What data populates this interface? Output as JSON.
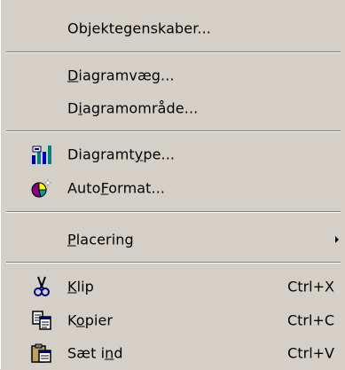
{
  "menu": {
    "items": [
      {
        "label_pre": "Ob",
        "label_acc": "j",
        "label_post": "ektegenskaber...",
        "shortcut": "",
        "icon": "",
        "submenu": false
      },
      {
        "label_pre": "",
        "label_acc": "D",
        "label_post": "iagramvæg...",
        "shortcut": "",
        "icon": "",
        "submenu": false
      },
      {
        "label_pre": "D",
        "label_acc": "i",
        "label_post": "agramområde...",
        "shortcut": "",
        "icon": "",
        "submenu": false
      },
      {
        "label_pre": "Diagramt",
        "label_acc": "y",
        "label_post": "pe...",
        "shortcut": "",
        "icon": "chart-type-icon",
        "submenu": false
      },
      {
        "label_pre": "Auto",
        "label_acc": "F",
        "label_post": "ormat...",
        "shortcut": "",
        "icon": "autoformat-icon",
        "submenu": false
      },
      {
        "label_pre": "",
        "label_acc": "P",
        "label_post": "lacering",
        "shortcut": "",
        "icon": "",
        "submenu": true
      },
      {
        "label_pre": "",
        "label_acc": "K",
        "label_post": "lip",
        "shortcut": "Ctrl+X",
        "icon": "scissors-icon",
        "submenu": false
      },
      {
        "label_pre": "K",
        "label_acc": "o",
        "label_post": "pier",
        "shortcut": "Ctrl+C",
        "icon": "copy-icon",
        "submenu": false
      },
      {
        "label_pre": "Sæt i",
        "label_acc": "n",
        "label_post": "d",
        "shortcut": "Ctrl+V",
        "icon": "paste-icon",
        "submenu": false
      }
    ]
  },
  "colors": {
    "menu_bg": "#d4d0c8",
    "separator_dark": "#808080",
    "separator_light": "#ffffff"
  }
}
